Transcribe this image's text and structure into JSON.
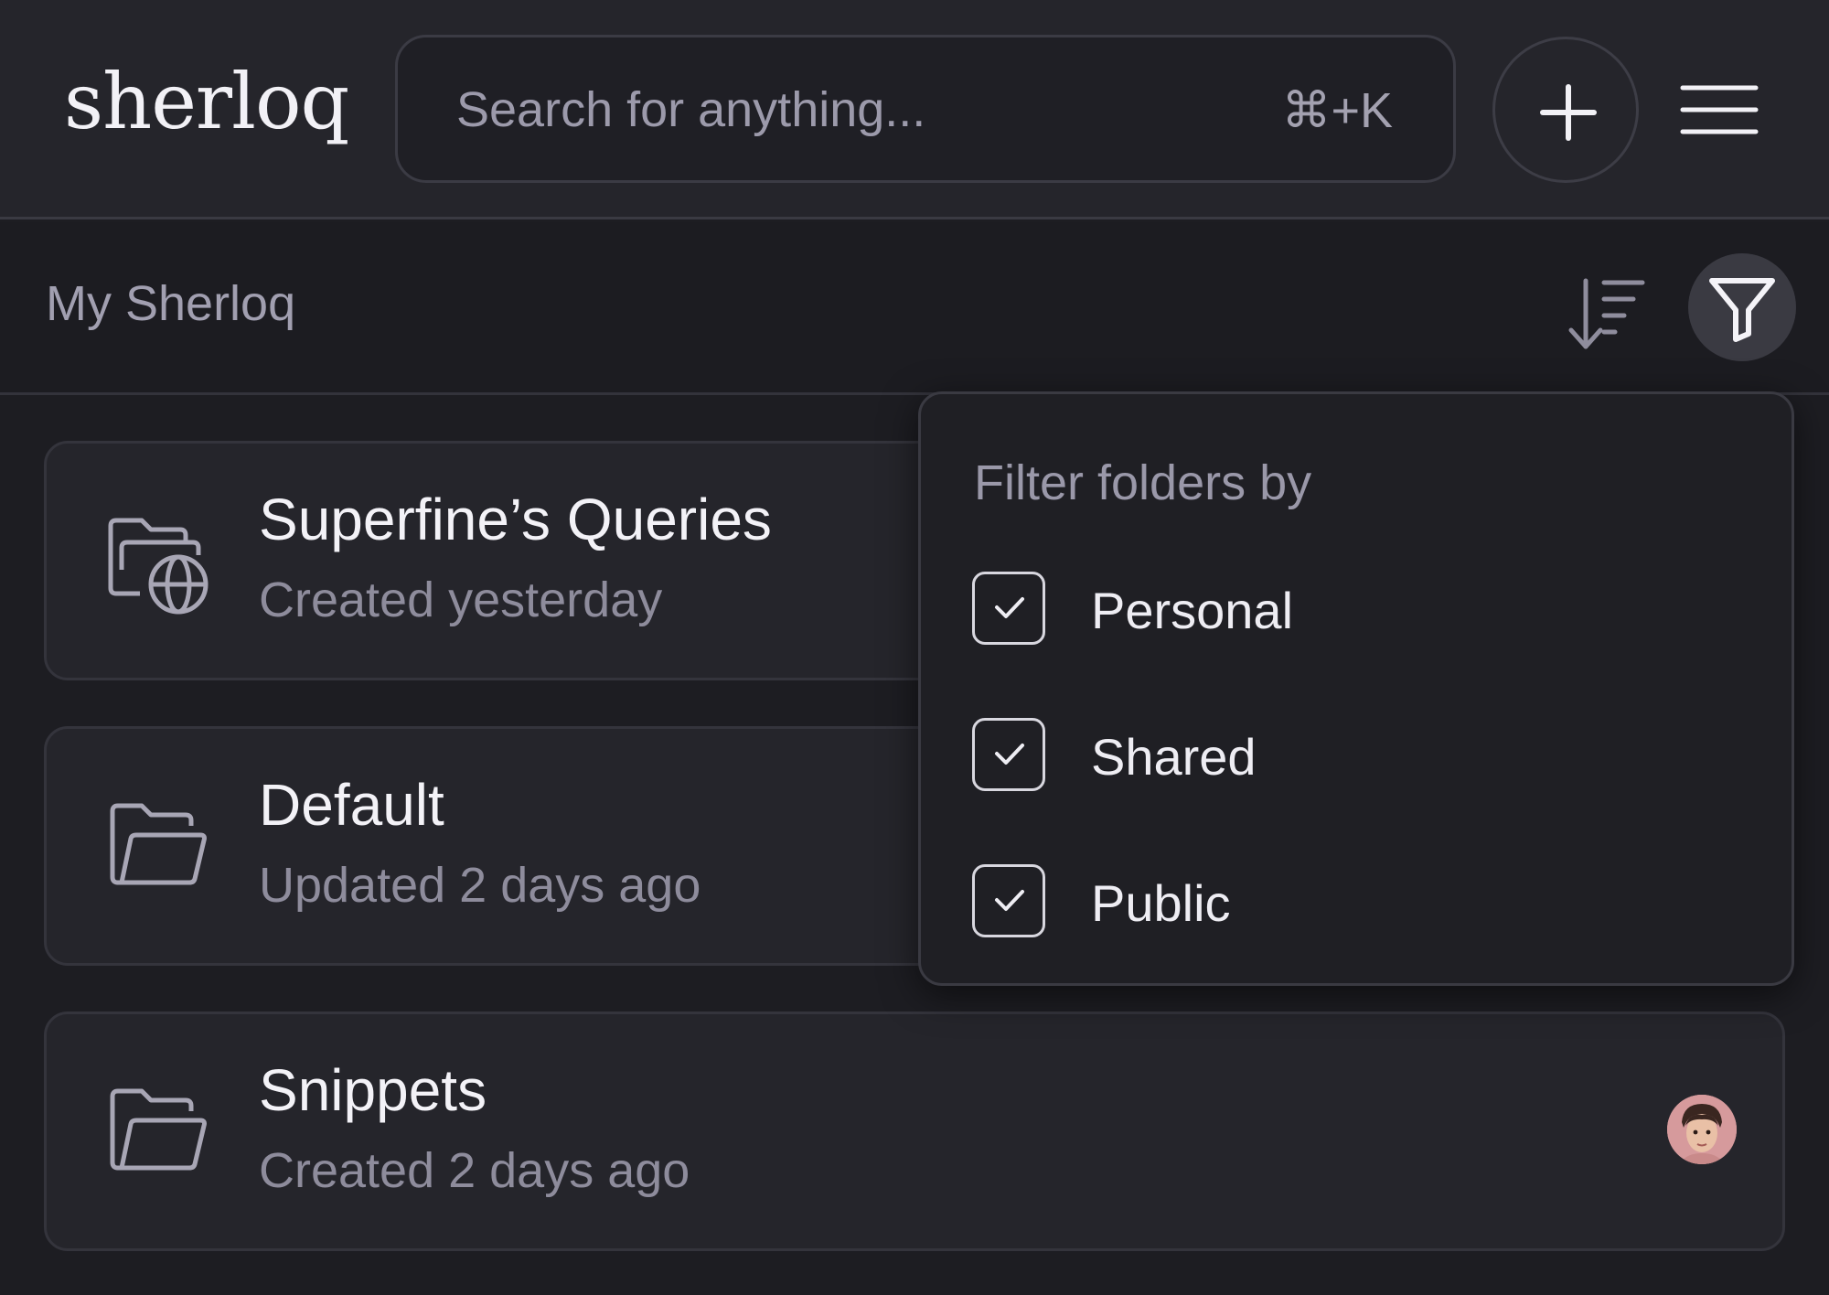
{
  "header": {
    "logo": "sherloq",
    "search": {
      "placeholder": "Search for anything...",
      "shortcut": "⌘+K"
    },
    "add_icon": "plus-icon",
    "menu_icon": "hamburger-menu-icon"
  },
  "subheader": {
    "breadcrumb": "My Sherloq",
    "sort_icon": "sort-descending-icon",
    "filter_icon": "filter-funnel-icon"
  },
  "folders": [
    {
      "title": "Superfine’s Queries",
      "subtitle": "Created yesterday",
      "icon": "folder-globe-icon"
    },
    {
      "title": "Default",
      "subtitle": "Updated 2 days ago",
      "icon": "folder-open-icon"
    },
    {
      "title": "Snippets",
      "subtitle": "Created 2 days ago",
      "icon": "folder-open-icon"
    }
  ],
  "filter_dropdown": {
    "title": "Filter folders by",
    "options": [
      {
        "label": "Personal",
        "checked": true
      },
      {
        "label": "Shared",
        "checked": true
      },
      {
        "label": "Public",
        "checked": true
      }
    ]
  },
  "colors": {
    "background": "#1d1d22",
    "header": "#25252b",
    "card": "#25252b",
    "text_primary": "#f3f2f7",
    "text_secondary": "#8e8c9c"
  }
}
